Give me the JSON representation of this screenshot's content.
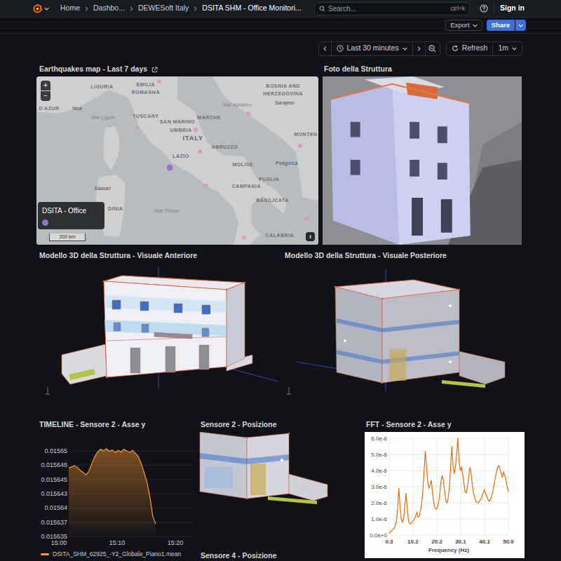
{
  "header": {
    "breadcrumbs": [
      {
        "label": "Home"
      },
      {
        "label": "Dashbo..."
      },
      {
        "label": "DEWESoft Italy"
      },
      {
        "label": "DSITA SHM - Office Monitori..."
      }
    ],
    "search": {
      "placeholder": "Search...",
      "shortcut": "ctrl+k"
    },
    "sign_in": "Sign in"
  },
  "toolbar": {
    "export": "Export",
    "share": "Share"
  },
  "time_picker": {
    "range": "Last 30 minutes",
    "refresh": "Refresh",
    "interval": "1m"
  },
  "map_panel": {
    "title": "Earthquakes map - Last 7 days",
    "zoom_in": "+",
    "zoom_out": "−",
    "info": "i",
    "scale": "200 km",
    "legend": {
      "label": "DSITA - Office",
      "color": "#9a73c9"
    },
    "office": {
      "lat": 41.5,
      "lon": 12.2
    },
    "labels": [
      {
        "text": "LIGURIA",
        "kind": "region",
        "lat": 44.49,
        "lon": 8.53
      },
      {
        "text": "EMILIA",
        "kind": "region",
        "lat": 44.57,
        "lon": 10.89
      },
      {
        "text": "ROMAGNA",
        "kind": "region",
        "lat": 44.28,
        "lon": 10.89
      },
      {
        "text": "D'AZUR",
        "kind": "region",
        "lat": 43.7,
        "lon": 5.68
      },
      {
        "text": "Nice",
        "kind": "city",
        "lat": 43.7,
        "lon": 7.2
      },
      {
        "text": "Mar Ligure",
        "kind": "sea",
        "lat": 43.36,
        "lon": 8.61
      },
      {
        "text": "TUSCANY",
        "kind": "region",
        "lat": 43.41,
        "lon": 10.89
      },
      {
        "text": "SAN MARINO",
        "kind": "region",
        "lat": 43.2,
        "lon": 12.6
      },
      {
        "text": "MARCHE",
        "kind": "region",
        "lat": 43.36,
        "lon": 14.31
      },
      {
        "text": "UMBRIA",
        "kind": "region",
        "lat": 42.88,
        "lon": 12.79
      },
      {
        "text": "ITALY",
        "kind": "country",
        "lat": 42.57,
        "lon": 13.44
      },
      {
        "text": "LAZIO",
        "kind": "region",
        "lat": 41.93,
        "lon": 12.79
      },
      {
        "text": "ABRUZZO",
        "kind": "region",
        "lat": 42.25,
        "lon": 15.15
      },
      {
        "text": "Mar Adriatico",
        "kind": "sea",
        "lat": 43.83,
        "lon": 15.83
      },
      {
        "text": "MOLISE",
        "kind": "region",
        "lat": 41.62,
        "lon": 16.13
      },
      {
        "text": "Podgorica",
        "kind": "city",
        "lat": 41.67,
        "lon": 18.49
      },
      {
        "text": "CAMPANIA",
        "kind": "region",
        "lat": 40.8,
        "lon": 16.32
      },
      {
        "text": "PUGLIA",
        "kind": "region",
        "lat": 41.06,
        "lon": 17.54
      },
      {
        "text": "BASILICATA",
        "kind": "region",
        "lat": 40.27,
        "lon": 17.73
      },
      {
        "text": "CALABRIA",
        "kind": "region",
        "lat": 38.98,
        "lon": 18.11
      },
      {
        "text": "BOSNIA AND",
        "kind": "region",
        "lat": 44.52,
        "lon": 18.3
      },
      {
        "text": "HERZEGOVINA",
        "kind": "region",
        "lat": 44.23,
        "lon": 18.3
      },
      {
        "text": "Sarajevo",
        "kind": "city",
        "lat": 43.89,
        "lon": 18.38
      },
      {
        "text": "MONTEN",
        "kind": "region",
        "lat": 42.73,
        "lon": 19.52
      },
      {
        "text": "Mar Tirreno",
        "kind": "sea",
        "lat": 39.88,
        "lon": 12.03
      },
      {
        "text": "Sassari",
        "kind": "city",
        "lat": 40.72,
        "lon": 8.56
      },
      {
        "text": "DINIA",
        "kind": "region",
        "lat": 39.98,
        "lon": 9.26
      }
    ],
    "earthquakes": [
      {
        "lat": 40.83,
        "lon": 14.14
      },
      {
        "lat": 42.9,
        "lon": 13.6
      },
      {
        "lat": 38.9,
        "lon": 16.2
      },
      {
        "lat": 42.1,
        "lon": 13.8
      },
      {
        "lat": 44.7,
        "lon": 11.6
      },
      {
        "lat": 43.5,
        "lon": 16.4
      },
      {
        "lat": 42.3,
        "lon": 19.2
      },
      {
        "lat": 43.0,
        "lon": 10.4
      },
      {
        "lat": 39.6,
        "lon": 19.6
      }
    ]
  },
  "photo_panel": {
    "title": "Foto della Struttura"
  },
  "model_front": {
    "title": "Modello 3D della Struttura - Visuale Anteriore"
  },
  "model_back": {
    "title": "Modello 3D della Struttura - Visuale Posteriore"
  },
  "timeline": {
    "title": "TIMELINE - Sensore 2 - Asse y",
    "y_ticks": [
      "0.01565",
      "0.015648",
      "0.015645",
      "0.015643",
      "0.01564",
      "0.015637",
      "0.015635"
    ],
    "x_ticks": [
      "15:00",
      "15:10",
      "15:20"
    ],
    "legend": "DSITA_SHM_62925_-Y2_Globale_Piano1.mean",
    "values": [
      0.015647,
      0.0156472,
      0.0156474,
      0.0156471,
      0.0156466,
      0.0156462,
      0.0156458,
      0.0156465,
      0.0156478,
      0.015649,
      0.0156498,
      0.0156503,
      0.01565,
      0.0156504,
      0.0156499,
      0.0156502,
      0.0156497,
      0.0156501,
      0.0156498,
      0.0156503,
      0.01565,
      0.0156497,
      0.0156501,
      0.0156496,
      0.015649,
      0.0156478,
      0.0156462,
      0.0156445,
      0.015642,
      0.0156385,
      0.0156372
    ]
  },
  "sensor2": {
    "title": "Sensore 2 - Posizione"
  },
  "fft": {
    "title": "FFT - Sensore 2 - Asse y",
    "y_ticks": [
      "6.0e-6",
      "5.0e-6",
      "4.0e-6",
      "3.0e-6",
      "2.0e-6",
      "1.0e-6",
      "0.0e+0"
    ],
    "x_ticks": [
      "0.3",
      "10.2",
      "20.2",
      "30.1",
      "40.1",
      "50.0"
    ],
    "x_label": "Frequency (Hz)",
    "values": [
      1e-07,
      2e-07,
      3e-07,
      3.5e-07,
      4e-07,
      5.5e-07,
      9e-07,
      1.6e-06,
      2.9e-06,
      1.8e-06,
      1e-06,
      8e-07,
      1e-06,
      1.8e-06,
      2.6e-06,
      1.6e-06,
      9e-07,
      7e-07,
      7e-07,
      8e-07,
      9e-07,
      1e-06,
      1.2e-06,
      1.4e-06,
      1.1e-06,
      1.2e-06,
      1.5e-06,
      2e-06,
      2.8e-06,
      4e-06,
      5.2e-06,
      4.3e-06,
      3.3e-06,
      2.9e-06,
      3.1e-06,
      3.4e-06,
      2.6e-06,
      2e-06,
      1.7e-06,
      1.6e-06,
      1.7e-06,
      2e-06,
      2.6e-06,
      3.3e-06,
      3.7e-06,
      3.4e-06,
      2.7e-06,
      2.1e-06,
      2e-06,
      2.3e-06,
      3e-06,
      4.2e-06,
      5.5e-06,
      4.4e-06,
      3.8e-06,
      4.2e-06,
      5e-06,
      6e-06,
      4.6e-06,
      4e-06,
      4.2e-06,
      3.8e-06,
      3.2e-06,
      2.7e-06,
      2.6e-06,
      3e-06,
      3.6e-06,
      4.2e-06,
      3.8e-06,
      3.1e-06,
      2.6e-06,
      2.3e-06,
      2.1e-06,
      2e-06,
      2e-06,
      2.1e-06,
      2.2e-06,
      2.4e-06,
      2.6e-06,
      2.8e-06,
      2.6e-06,
      2.4e-06,
      2.2e-06,
      2.1e-06,
      2.2e-06,
      2.4e-06,
      2.7e-06,
      3.1e-06,
      3.5e-06,
      3.9e-06,
      4.2e-06,
      4.3e-06,
      4.1e-06,
      3.8e-06,
      3.6e-06,
      3.9e-06,
      3.7e-06,
      3.4e-06,
      3e-06,
      2.7e-06
    ]
  },
  "sensor4": {
    "title": "Sensore 4 - Posizione"
  }
}
